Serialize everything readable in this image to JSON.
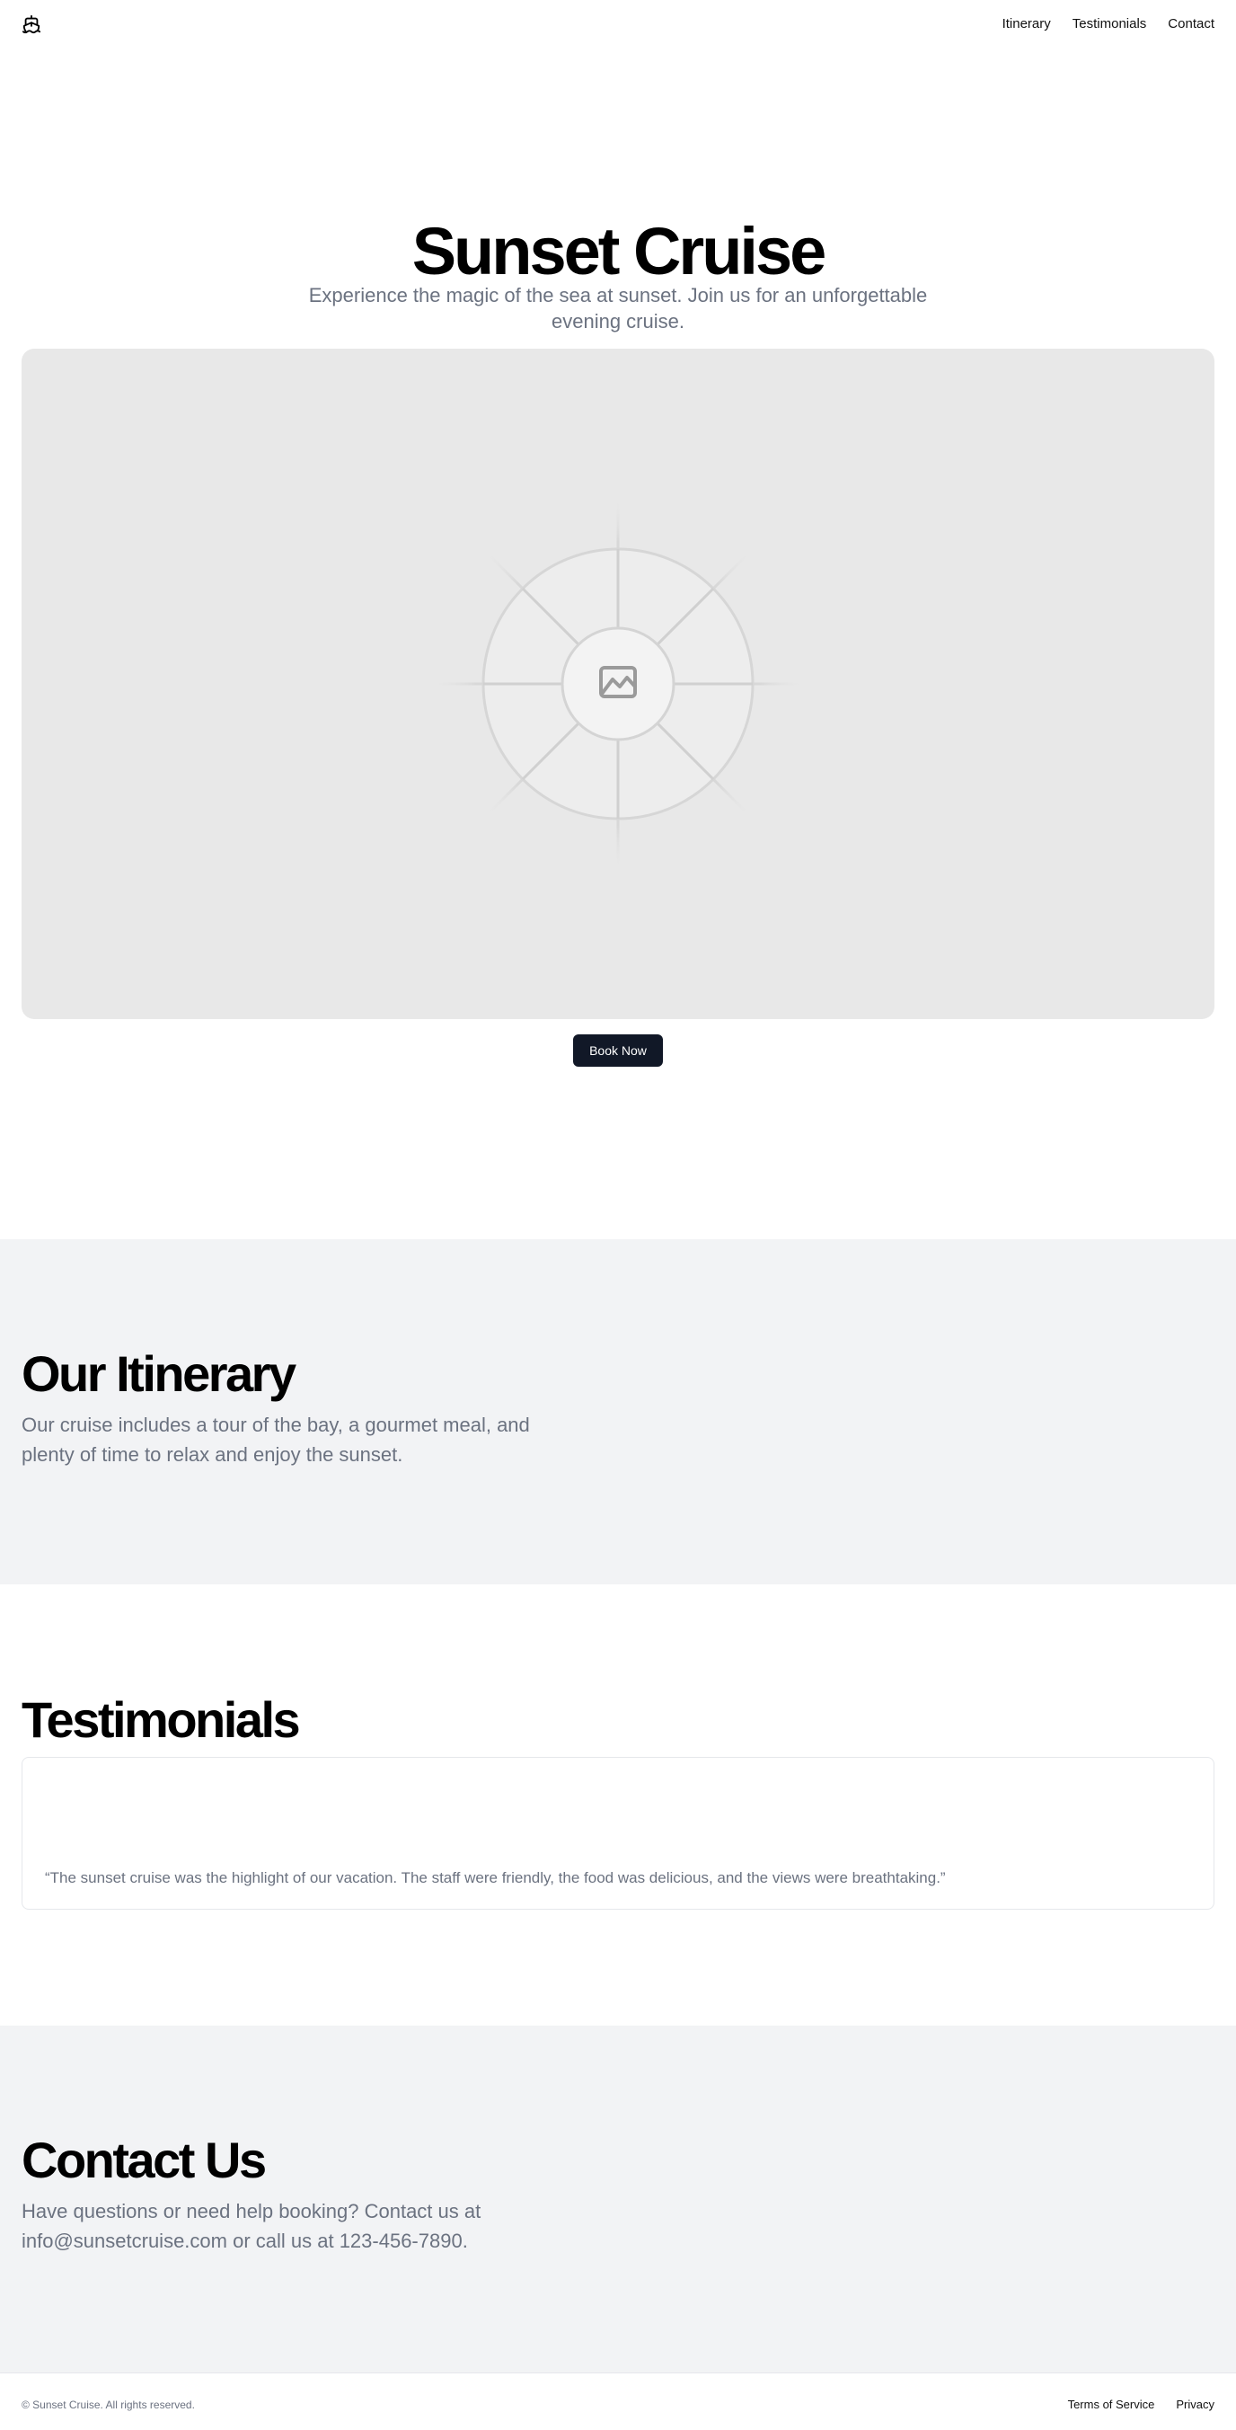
{
  "header": {
    "logo_icon": "ship-icon",
    "nav": [
      {
        "label": "Itinerary"
      },
      {
        "label": "Testimonials"
      },
      {
        "label": "Contact"
      }
    ]
  },
  "hero": {
    "title": "Sunset Cruise",
    "subtitle": "Experience the magic of the sea at sunset. Join us for an unforgettable evening cruise.",
    "image_icon": "image-placeholder-icon",
    "cta_label": "Book Now"
  },
  "itinerary": {
    "title": "Our Itinerary",
    "text": "Our cruise includes a tour of the bay, a gourmet meal, and plenty of time to relax and enjoy the sunset."
  },
  "testimonials": {
    "title": "Testimonials",
    "items": [
      {
        "quote": "“The sunset cruise was the highlight of our vacation. The staff were friendly, the food was delicious, and the views were breathtaking.”"
      }
    ]
  },
  "contact": {
    "title": "Contact Us",
    "text": "Have questions or need help booking? Contact us at info@sunsetcruise.com or call us at 123-456-7890."
  },
  "footer": {
    "copyright": "© Sunset Cruise. All rights reserved.",
    "links": [
      {
        "label": "Terms of Service"
      },
      {
        "label": "Privacy"
      }
    ]
  },
  "colors": {
    "primary_button": "#111827",
    "muted_text": "#6b7280",
    "section_bg": "#f2f3f5",
    "placeholder_bg": "#e8e8e8"
  }
}
